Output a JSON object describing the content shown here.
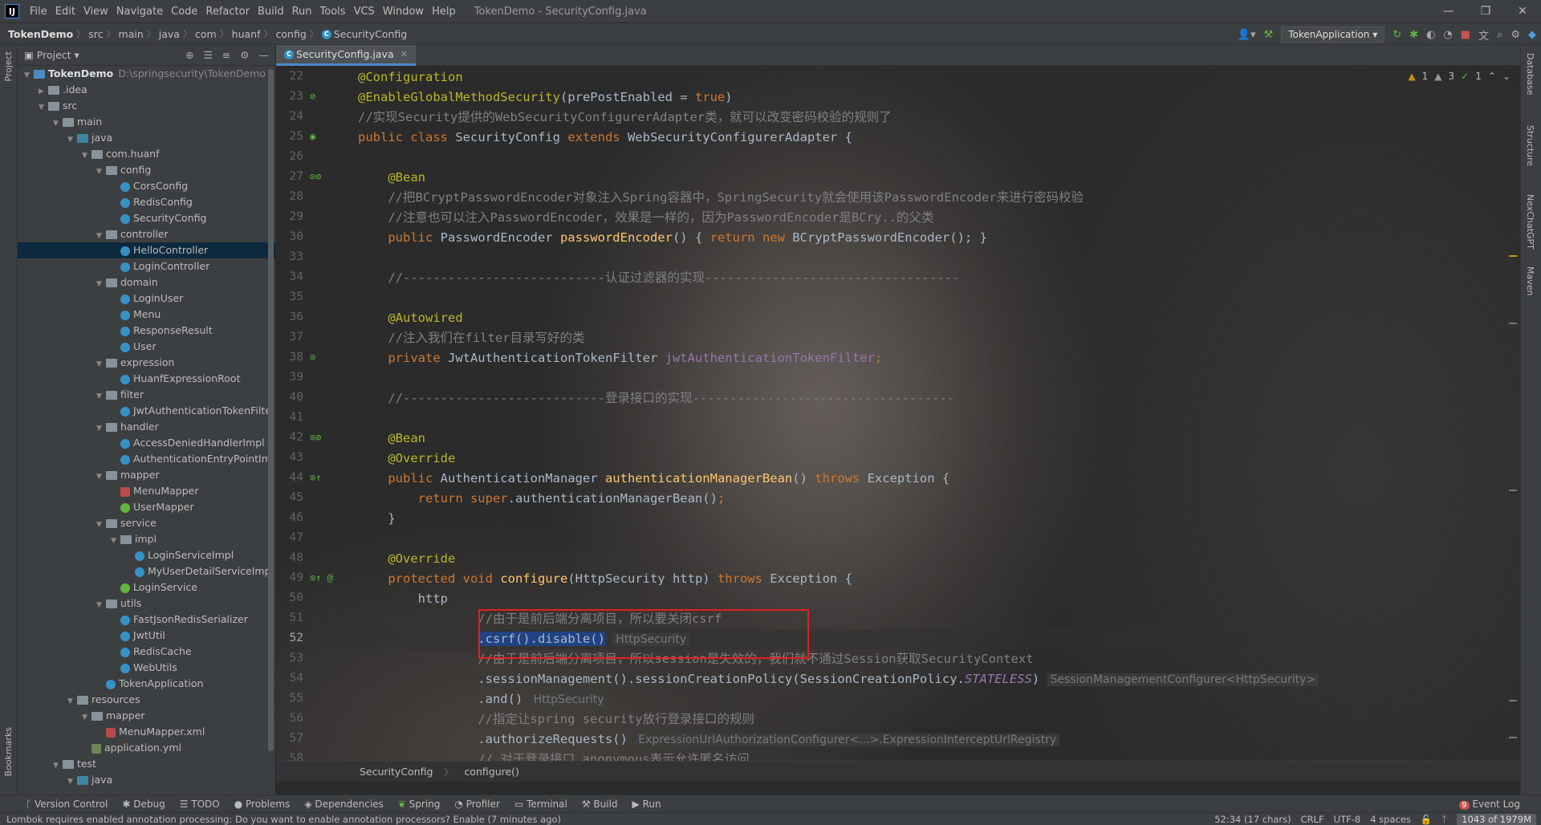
{
  "menubar": {
    "logo": "IJ",
    "items": [
      "File",
      "Edit",
      "View",
      "Navigate",
      "Code",
      "Refactor",
      "Build",
      "Run",
      "Tools",
      "VCS",
      "Window",
      "Help"
    ],
    "title": "TokenDemo - SecurityConfig.java",
    "window_controls": [
      "—",
      "❐",
      "✕"
    ]
  },
  "navbar": {
    "crumbs": [
      "TokenDemo",
      "src",
      "main",
      "java",
      "com",
      "huanf",
      "config",
      "SecurityConfig"
    ],
    "run_config": "TokenApplication"
  },
  "project": {
    "header": "Project",
    "tree": [
      {
        "label": "TokenDemo",
        "path": "D:\\springsecurity\\TokenDemo",
        "depth": 0,
        "type": "module",
        "open": true
      },
      {
        "label": ".idea",
        "depth": 1,
        "type": "folder",
        "open": false
      },
      {
        "label": "src",
        "depth": 1,
        "type": "folder",
        "open": true
      },
      {
        "label": "main",
        "depth": 2,
        "type": "folder",
        "open": true
      },
      {
        "label": "java",
        "depth": 3,
        "type": "src",
        "open": true
      },
      {
        "label": "com.huanf",
        "depth": 4,
        "type": "folder",
        "open": true
      },
      {
        "label": "config",
        "depth": 5,
        "type": "folder",
        "open": true
      },
      {
        "label": "CorsConfig",
        "depth": 6,
        "type": "class"
      },
      {
        "label": "RedisConfig",
        "depth": 6,
        "type": "class"
      },
      {
        "label": "SecurityConfig",
        "depth": 6,
        "type": "class"
      },
      {
        "label": "controller",
        "depth": 5,
        "type": "folder",
        "open": true
      },
      {
        "label": "HelloController",
        "depth": 6,
        "type": "class",
        "selected": true
      },
      {
        "label": "LoginController",
        "depth": 6,
        "type": "class"
      },
      {
        "label": "domain",
        "depth": 5,
        "type": "folder",
        "open": true
      },
      {
        "label": "LoginUser",
        "depth": 6,
        "type": "class"
      },
      {
        "label": "Menu",
        "depth": 6,
        "type": "class"
      },
      {
        "label": "ResponseResult",
        "depth": 6,
        "type": "class"
      },
      {
        "label": "User",
        "depth": 6,
        "type": "class"
      },
      {
        "label": "expression",
        "depth": 5,
        "type": "folder",
        "open": true
      },
      {
        "label": "HuanfExpressionRoot",
        "depth": 6,
        "type": "class"
      },
      {
        "label": "filter",
        "depth": 5,
        "type": "folder",
        "open": true
      },
      {
        "label": "JwtAuthenticationTokenFilte",
        "depth": 6,
        "type": "class"
      },
      {
        "label": "handler",
        "depth": 5,
        "type": "folder",
        "open": true
      },
      {
        "label": "AccessDeniedHandlerImpl",
        "depth": 6,
        "type": "class"
      },
      {
        "label": "AuthenticationEntryPointIm",
        "depth": 6,
        "type": "class"
      },
      {
        "label": "mapper",
        "depth": 5,
        "type": "folder",
        "open": true
      },
      {
        "label": "MenuMapper",
        "depth": 6,
        "type": "mapper"
      },
      {
        "label": "UserMapper",
        "depth": 6,
        "type": "interface"
      },
      {
        "label": "service",
        "depth": 5,
        "type": "folder",
        "open": true
      },
      {
        "label": "impl",
        "depth": 6,
        "type": "folder",
        "open": true
      },
      {
        "label": "LoginServiceImpl",
        "depth": 7,
        "type": "class"
      },
      {
        "label": "MyUserDetailServiceImp",
        "depth": 7,
        "type": "class"
      },
      {
        "label": "LoginService",
        "depth": 6,
        "type": "interface"
      },
      {
        "label": "utils",
        "depth": 5,
        "type": "folder",
        "open": true
      },
      {
        "label": "FastJsonRedisSerializer",
        "depth": 6,
        "type": "class"
      },
      {
        "label": "JwtUtil",
        "depth": 6,
        "type": "class"
      },
      {
        "label": "RedisCache",
        "depth": 6,
        "type": "class"
      },
      {
        "label": "WebUtils",
        "depth": 6,
        "type": "class"
      },
      {
        "label": "TokenApplication",
        "depth": 5,
        "type": "class"
      },
      {
        "label": "resources",
        "depth": 3,
        "type": "folder",
        "open": true
      },
      {
        "label": "mapper",
        "depth": 4,
        "type": "folder",
        "open": true
      },
      {
        "label": "MenuMapper.xml",
        "depth": 5,
        "type": "xml"
      },
      {
        "label": "application.yml",
        "depth": 4,
        "type": "yml"
      },
      {
        "label": "test",
        "depth": 2,
        "type": "folder",
        "open": true
      },
      {
        "label": "java",
        "depth": 3,
        "type": "src",
        "open": true
      }
    ]
  },
  "editor": {
    "tab": "SecurityConfig.java",
    "inspections": {
      "warnings": "1",
      "weak": "3",
      "typos": "1"
    },
    "lines": [
      {
        "n": "22",
        "html": "<span class='an'>@Configuration</span>"
      },
      {
        "n": "23",
        "html": "<span class='an'>@EnableGlobalMethodSecurity</span>(prePostEnabled = <span class='kw'>true</span>)"
      },
      {
        "n": "24",
        "html": "<span class='cm'>//实现Security提供的WebSecurityConfigurerAdapter类，就可以改变密码校验的规则了</span>"
      },
      {
        "n": "25",
        "html": "<span class='kw'>public class </span>SecurityConfig <span class='kw'>extends </span>WebSecurityConfigurerAdapter {"
      },
      {
        "n": "26",
        "html": ""
      },
      {
        "n": "27",
        "html": "    <span class='an'>@Bean</span>"
      },
      {
        "n": "28",
        "html": "    <span class='cm'>//把BCryptPasswordEncoder对象注入Spring容器中，SpringSecurity就会使用该PasswordEncoder来进行密码校验</span>"
      },
      {
        "n": "29",
        "html": "    <span class='cm'>//注意也可以注入PasswordEncoder，效果是一样的，因为PasswordEncoder是BCry..的父类</span>"
      },
      {
        "n": "30",
        "html": "    <span class='kw'>public </span>PasswordEncoder <span class='fn'>passwordEncoder</span>() { <span class='kw'>return new </span>BCryptPasswordEncoder(); }"
      },
      {
        "n": "33",
        "html": ""
      },
      {
        "n": "34",
        "html": "    <span class='cm'>//---------------------------认证过滤器的实现----------------------------------</span>"
      },
      {
        "n": "35",
        "html": ""
      },
      {
        "n": "36",
        "html": "    <span class='an'>@Autowired</span>"
      },
      {
        "n": "37",
        "html": "    <span class='cm'>//注入我们在filter目录写好的类</span>"
      },
      {
        "n": "38",
        "html": "    <span class='kw'>private </span>JwtAuthenticationTokenFilter <span class='fld'>jwtAuthenticationTokenFilter</span><span class='kw'>;</span>"
      },
      {
        "n": "39",
        "html": ""
      },
      {
        "n": "40",
        "html": "    <span class='cm'>//---------------------------登录接口的实现-----------------------------------</span>"
      },
      {
        "n": "41",
        "html": ""
      },
      {
        "n": "42",
        "html": "    <span class='an'>@Bean</span>"
      },
      {
        "n": "43",
        "html": "    <span class='an'>@Override</span>"
      },
      {
        "n": "44",
        "html": "    <span class='kw'>public </span>AuthenticationManager <span class='fn'>authenticationManagerBean</span>() <span class='kw'>throws </span>Exception {"
      },
      {
        "n": "45",
        "html": "        <span class='kw'>return super</span>.authenticationManagerBean()<span class='kw'>;</span>"
      },
      {
        "n": "46",
        "html": "    }"
      },
      {
        "n": "47",
        "html": ""
      },
      {
        "n": "48",
        "html": "    <span class='an'>@Override</span>"
      },
      {
        "n": "49",
        "html": "    <span class='kw'>protected void </span><span class='fn'>configure</span>(HttpSecurity http) <span class='kw'>throws </span>Exception {"
      },
      {
        "n": "50",
        "html": "        http"
      },
      {
        "n": "51",
        "html": "                <span class='cm'>//由于是前后端分离项目，所以要关闭csrf</span>"
      },
      {
        "n": "52",
        "html": "                <span class='selt'>.csrf().disable()</span> <span class='hint'>HttpSecurity</span>"
      },
      {
        "n": "53",
        "html": "                <span class='cm'>//由于是前后端分离项目，所以session是失效的，我们就不通过Session获取SecurityContext</span>"
      },
      {
        "n": "54",
        "html": "                .sessionManagement().sessionCreationPolicy(SessionCreationPolicy.<span class='st'>STATELESS</span>) <span class='hint'>SessionManagementConfigurer&lt;HttpSecurity&gt;</span>"
      },
      {
        "n": "55",
        "html": "                .and() <span class='hint'>HttpSecurity</span>"
      },
      {
        "n": "56",
        "html": "                <span class='cm'>//指定让spring security放行登录接口的规则</span>"
      },
      {
        "n": "57",
        "html": "                .authorizeRequests() <span class='hint'>ExpressionUrlAuthorizationConfigurer&lt;...&gt;.ExpressionInterceptUrlRegistry</span>"
      },
      {
        "n": "58",
        "html": "                <span class='cm'>// 对于登录接口 anonymous表示允许匿名访问</span>"
      }
    ],
    "breadcrumb": [
      "SecurityConfig",
      "configure()"
    ]
  },
  "right_tools": [
    "Database",
    "Structure",
    "NexChatGPT",
    "Maven"
  ],
  "left_tools": {
    "project": "Project",
    "bookmarks": "Bookmarks"
  },
  "toolwindows": [
    "Version Control",
    "Debug",
    "TODO",
    "Problems",
    "Dependencies",
    "Spring",
    "Profiler",
    "Terminal",
    "Build",
    "Run"
  ],
  "event_log": "Event Log",
  "event_count": "9",
  "status": {
    "message": "Lombok requires enabled annotation processing: Do you want to enable annotation processors? Enable (7 minutes ago)",
    "position": "52:34 (17 chars)",
    "line_sep": "CRLF",
    "encoding": "UTF-8",
    "indent": "4 spaces",
    "memory": "1043 of 1979M"
  }
}
